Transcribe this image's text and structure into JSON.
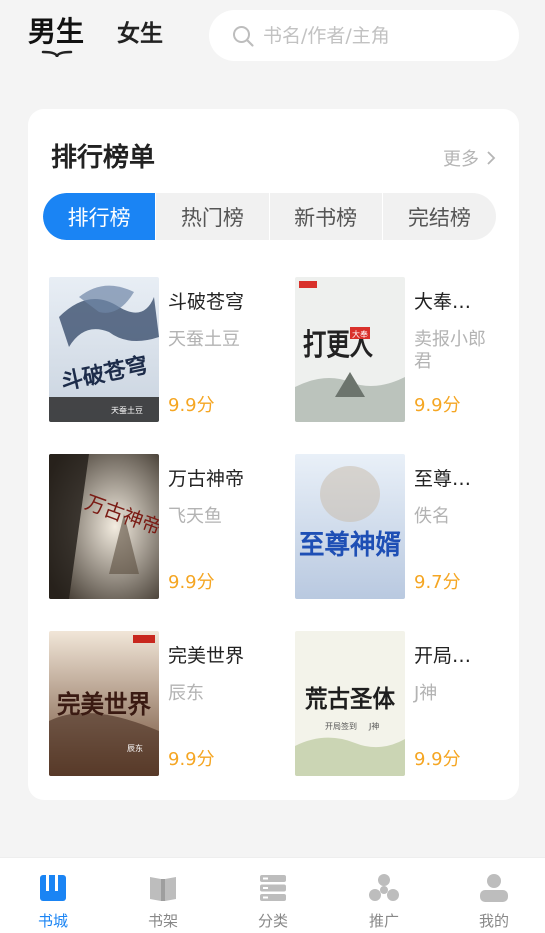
{
  "header": {
    "gender_tabs": [
      {
        "label": "男生",
        "active": true
      },
      {
        "label": "女生",
        "active": false
      }
    ],
    "search": {
      "placeholder": "书名/作者/主角",
      "value": ""
    }
  },
  "ranking": {
    "title": "排行榜单",
    "more_label": "更多",
    "tabs": [
      {
        "label": "排行榜",
        "active": true
      },
      {
        "label": "热门榜",
        "active": false
      },
      {
        "label": "新书榜",
        "active": false
      },
      {
        "label": "完结榜",
        "active": false
      }
    ],
    "books": [
      {
        "title": "斗破苍穹",
        "author": "天蚕土豆",
        "score": "9.9分",
        "cover_title": "斗破苍穹",
        "cover_author": "天蚕土豆"
      },
      {
        "title": "大奉打...",
        "author": "卖报小郎君",
        "score": "9.9分",
        "cover_title": "打更人",
        "cover_badge": "大奉"
      },
      {
        "title": "万古神帝",
        "author": "飞天鱼",
        "score": "9.9分",
        "cover_title": "万古神帝"
      },
      {
        "title": "至尊神...",
        "author": "佚名",
        "score": "9.7分",
        "cover_title": "至尊神婿"
      },
      {
        "title": "完美世界",
        "author": "辰东",
        "score": "9.9分",
        "cover_title": "完美世界",
        "cover_author": "辰东"
      },
      {
        "title": "开局签...",
        "author": "J神",
        "score": "9.9分",
        "cover_title": "荒古圣体",
        "cover_sub": "开局签到",
        "cover_author": "J神"
      }
    ]
  },
  "bottom_nav": [
    {
      "label": "书城",
      "icon": "bookstore-icon",
      "active": true
    },
    {
      "label": "书架",
      "icon": "bookshelf-icon",
      "active": false
    },
    {
      "label": "分类",
      "icon": "category-icon",
      "active": false
    },
    {
      "label": "推广",
      "icon": "promote-icon",
      "active": false
    },
    {
      "label": "我的",
      "icon": "profile-icon",
      "active": false
    }
  ],
  "colors": {
    "accent": "#1a84f4",
    "score": "#f5a623",
    "background": "#f4f4f4",
    "nav_inactive": "#888888"
  }
}
